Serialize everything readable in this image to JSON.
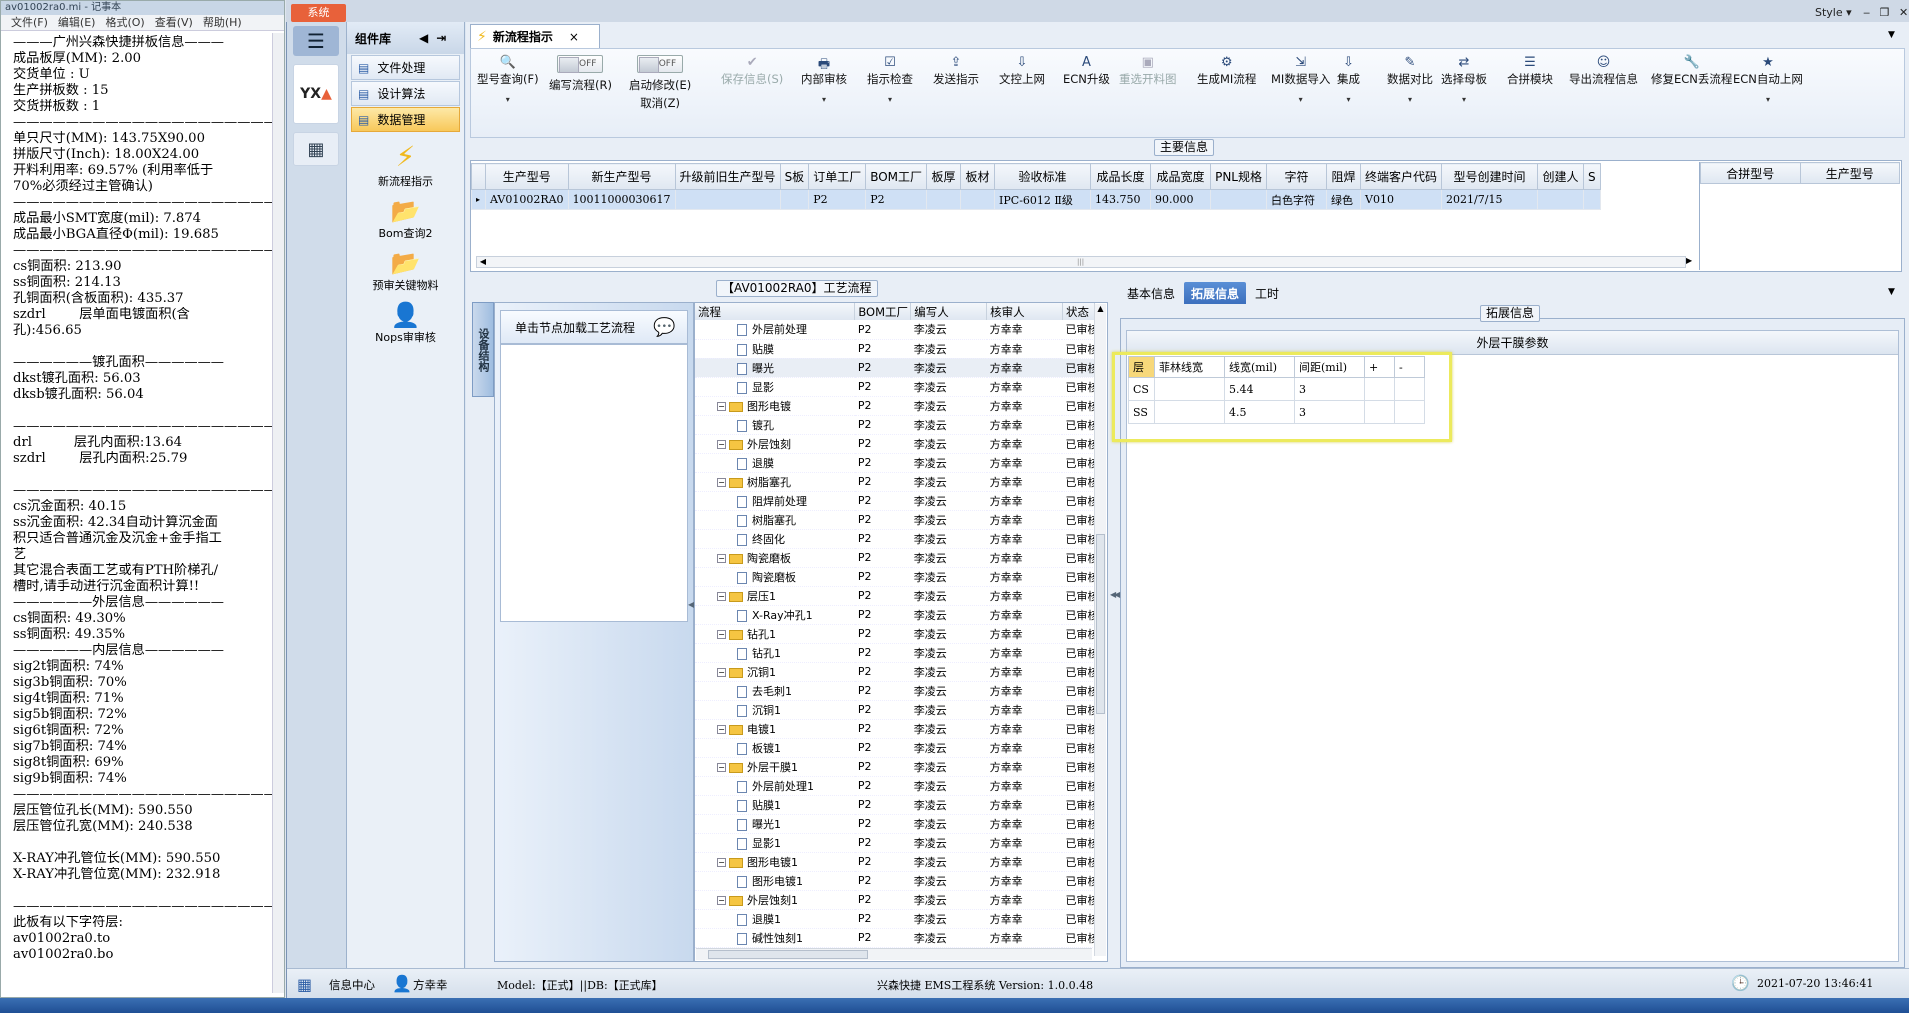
{
  "notepad": {
    "title": "av01002ra0.mi - 记事本",
    "menu": [
      "文件(F)",
      "编辑(E)",
      "格式(O)",
      "查看(V)",
      "帮助(H)"
    ],
    "lines": [
      "———广州兴森快捷拼板信息———",
      "成品板厚(MM): 2.00",
      "交货单位 : U",
      "生产拼板数 : 15",
      "交货拼板数 : 1",
      "————————————————————",
      "单只尺寸(MM): 143.75X90.00",
      "拼版尺寸(Inch): 18.00X24.00",
      "开料利用率: 69.57% (利用率低于",
      "70%必须经过主管确认)",
      "————————————————————",
      "成品最小SMT宽度(mil): 7.874",
      "成品最小BGA直径Φ(mil): 19.685",
      "————————————————————",
      "cs铜面积: 213.90",
      "ss铜面积: 214.13",
      "孔铜面积(含板面积): 435.37",
      "szdrl        层单面电镀面积(含",
      "孔):456.65",
      "",
      "——————镀孔面积——————",
      "dkst镀孔面积: 56.03",
      "dksb镀孔面积: 56.04",
      "",
      "————————————————————",
      "drl          层孔内面积:13.64",
      "szdrl        层孔内面积:25.79",
      "",
      "————————————————————",
      "cs沉金面积: 40.15",
      "ss沉金面积: 42.34自动计算沉金面",
      "积只适合普通沉金及沉金+金手指工",
      "艺",
      "其它混合表面工艺或有PTH阶梯孔/",
      "槽时,请手动进行沉金面积计算!!",
      "——————外层信息——————",
      "cs铜面积: 49.30%",
      "ss铜面积: 49.35%",
      "——————内层信息——————",
      "sig2t铜面积: 74%",
      "sig3b铜面积: 70%",
      "sig4t铜面积: 71%",
      "sig5b铜面积: 72%",
      "sig6t铜面积: 72%",
      "sig7b铜面积: 74%",
      "sig8t铜面积: 69%",
      "sig9b铜面积: 74%",
      "————————————————————",
      "层压管位孔长(MM): 590.550",
      "层压管位孔宽(MM): 240.538",
      "",
      "X-RAY冲孔管位长(MM): 590.550",
      "X-RAY冲孔管位宽(MM): 232.918",
      "",
      "————————————————————",
      "此板有以下字符层:",
      "av01002ra0.to",
      "av01002ra0.bo"
    ]
  },
  "app": {
    "sys_tab": "系统",
    "style_label": "Style",
    "component_lib": "组件库",
    "components": [
      "文件处理",
      "设计算法",
      "数据管理"
    ],
    "big_items": [
      "新流程指示",
      "Bom查询2",
      "预审关键物料",
      "Nops审审核"
    ],
    "doc_tab": "新流程指示",
    "toolbar": [
      {
        "label": "型号查询(F)",
        "icon": "🔍"
      },
      {
        "label": "编写流程(R)",
        "icon": "toggle",
        "toggle": "OFF"
      },
      {
        "label": "启动修改(E)",
        "label2": "取消(Z)",
        "icon": "toggle",
        "toggle": "OFF"
      },
      {
        "label": "保存信息(S)",
        "icon": "✔",
        "disabled": true
      },
      {
        "label": "内部审核",
        "icon": "🖶"
      },
      {
        "label": "指示检查",
        "icon": "☑"
      },
      {
        "label": "发送指示",
        "icon": "⇪"
      },
      {
        "label": "文控上网",
        "icon": "⇩"
      },
      {
        "label": "ECN升级",
        "icon": "A"
      },
      {
        "label": "重选开料图",
        "icon": "▣",
        "disabled": true
      },
      {
        "label": "生成MI流程",
        "icon": "⚙"
      },
      {
        "label": "MI数据导入",
        "icon": "⇲"
      },
      {
        "label": "集成",
        "icon": "⇩"
      },
      {
        "label": "数据对比",
        "icon": "✎"
      },
      {
        "label": "选择母板",
        "icon": "⇄"
      },
      {
        "label": "合拼模块",
        "icon": "☰"
      },
      {
        "label": "导出流程信息",
        "icon": "☺"
      },
      {
        "label": "修复ECN丢流程",
        "icon": "🔧"
      },
      {
        "label": "ECN自动上网",
        "icon": "★"
      }
    ],
    "main_info_title": "主要信息",
    "main_cols": [
      "生产型号",
      "新生产型号",
      "升级前旧生产型号",
      "S板",
      "订单工厂",
      "BOM工厂",
      "板厚",
      "板材",
      "验收标准",
      "成品长度",
      "成品宽度",
      "PNL规格",
      "字符",
      "阻焊",
      "终端客户代码",
      "型号创建时间",
      "创建人",
      "S"
    ],
    "main_row": [
      "AV01002RA0",
      "10011000030617",
      "",
      "",
      "P2",
      "P2",
      "",
      "",
      "IPC-6012 Ⅱ级",
      "143.750",
      "90.000",
      "",
      "白色字符",
      "绿色",
      "V010",
      "2021/7/15",
      "",
      ""
    ],
    "side_cols": [
      "合拼型号",
      "生产型号"
    ],
    "process_title": "【AV01002RA0】工艺流程",
    "vtab_label": "设备结构",
    "click_load": "单击节点加载工艺流程",
    "tree_cols": [
      "流程",
      "BOM工厂",
      "编写人",
      "核审人",
      "状态"
    ],
    "tree_rows": [
      {
        "t": "f",
        "name": "外层前处理",
        "lv": 2
      },
      {
        "t": "f",
        "name": "贴膜",
        "lv": 2
      },
      {
        "t": "f",
        "name": "曝光",
        "lv": 2
      },
      {
        "t": "f",
        "name": "显影",
        "lv": 2
      },
      {
        "t": "d",
        "name": "图形电镀",
        "lv": 1
      },
      {
        "t": "f",
        "name": "镀孔",
        "lv": 2
      },
      {
        "t": "d",
        "name": "外层蚀刻",
        "lv": 1
      },
      {
        "t": "f",
        "name": "退膜",
        "lv": 2
      },
      {
        "t": "d",
        "name": "树脂塞孔",
        "lv": 1
      },
      {
        "t": "f",
        "name": "阻焊前处理",
        "lv": 2
      },
      {
        "t": "f",
        "name": "树脂塞孔",
        "lv": 2
      },
      {
        "t": "f",
        "name": "终固化",
        "lv": 2
      },
      {
        "t": "d",
        "name": "陶瓷磨板",
        "lv": 1
      },
      {
        "t": "f",
        "name": "陶瓷磨板",
        "lv": 2
      },
      {
        "t": "d",
        "name": "层压1",
        "lv": 1
      },
      {
        "t": "f",
        "name": "X-Ray冲孔1",
        "lv": 2
      },
      {
        "t": "d",
        "name": "钻孔1",
        "lv": 1
      },
      {
        "t": "f",
        "name": "钻孔1",
        "lv": 2
      },
      {
        "t": "d",
        "name": "沉铜1",
        "lv": 1
      },
      {
        "t": "f",
        "name": "去毛刺1",
        "lv": 2
      },
      {
        "t": "f",
        "name": "沉铜1",
        "lv": 2
      },
      {
        "t": "d",
        "name": "电镀1",
        "lv": 1
      },
      {
        "t": "f",
        "name": "板镀1",
        "lv": 2
      },
      {
        "t": "d",
        "name": "外层干膜1",
        "lv": 1
      },
      {
        "t": "f",
        "name": "外层前处理1",
        "lv": 2
      },
      {
        "t": "f",
        "name": "贴膜1",
        "lv": 2
      },
      {
        "t": "f",
        "name": "曝光1",
        "lv": 2
      },
      {
        "t": "f",
        "name": "显影1",
        "lv": 2
      },
      {
        "t": "d",
        "name": "图形电镀1",
        "lv": 1
      },
      {
        "t": "f",
        "name": "图形电镀1",
        "lv": 2
      },
      {
        "t": "d",
        "name": "外层蚀刻1",
        "lv": 1
      },
      {
        "t": "f",
        "name": "退膜1",
        "lv": 2
      },
      {
        "t": "f",
        "name": "碱性蚀刻1",
        "lv": 2
      }
    ],
    "tree_factory": "P2",
    "tree_writer": "李凌云",
    "tree_checker": "方幸幸",
    "tree_status": "已审核",
    "right_tabs": [
      "基本信息",
      "拓展信息",
      "工时"
    ],
    "ext_title": "拓展信息",
    "outer_title": "外层干膜参数",
    "film_cols": [
      "层",
      "菲林线宽",
      "线宽(mil)",
      "间距(mil)",
      "+",
      "-"
    ],
    "film_rows": [
      [
        "CS",
        "",
        "5.44",
        "3",
        "",
        ""
      ],
      [
        "SS",
        "",
        "4.5",
        "3",
        "",
        ""
      ]
    ],
    "status": {
      "info": "信息中心",
      "user": "方幸幸",
      "model": "Model:【正式】||DB:【正式库】",
      "system": "兴森快捷  EMS工程系统  Version: 1.0.0.48",
      "date": "2021-07-20 13:46:41"
    }
  },
  "colors": {
    "accent": "#3c6fbd",
    "highlight": "#ecea5c",
    "sys": "#e8613a"
  }
}
